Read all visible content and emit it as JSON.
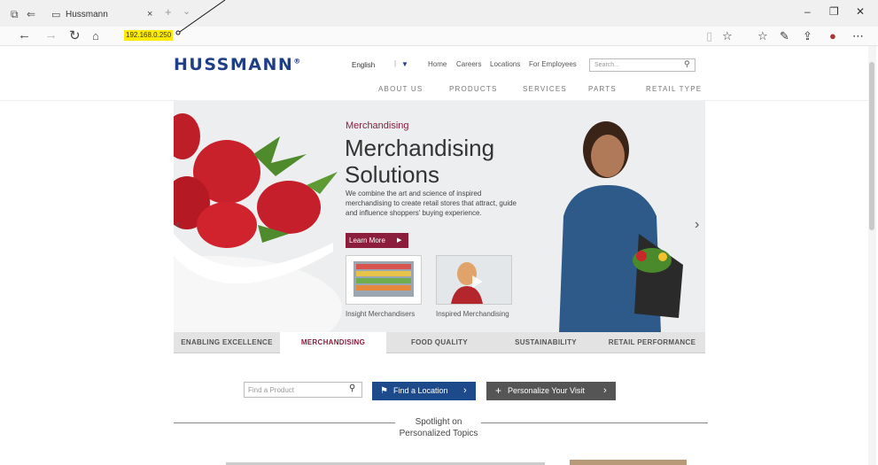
{
  "browser": {
    "tab_title": "Hussmann",
    "tab_close": "×",
    "new_tab": "+",
    "tab_menu": "⌄",
    "url": "192.168.0.250",
    "minimize": "–",
    "restore": "❐",
    "close": "✕"
  },
  "header": {
    "logo": "HUSSMANN",
    "logo_mark": "®",
    "language": "English",
    "top_links": [
      "Home",
      "Careers",
      "Locations",
      "For Employees"
    ],
    "search_placeholder": "Search...",
    "nav": [
      "ABOUT US",
      "PRODUCTS",
      "SERVICES",
      "PARTS",
      "RETAIL TYPE"
    ]
  },
  "hero": {
    "eyebrow": "Merchandising",
    "title": "Merchandising Solutions",
    "description": "We combine the art and science of inspired merchandising to create retail stores that attract, guide and influence shoppers' buying experience.",
    "cta": "Learn More",
    "thumbnails": [
      "Insight Merchandisers",
      "Inspired Merchandising"
    ],
    "tabs": [
      "ENABLING EXCELLENCE",
      "MERCHANDISING",
      "FOOD QUALITY",
      "SUSTAINABILITY",
      "RETAIL PERFORMANCE"
    ],
    "active_tab": "MERCHANDISING"
  },
  "tools": {
    "find_product_placeholder": "Find a Product",
    "find_location": "Find a Location",
    "personalize": "Personalize Your Visit"
  },
  "spotlight": {
    "heading": "Spotlight on Personalized Topics"
  },
  "colors": {
    "brand_blue": "#1f3e88",
    "accent_maroon": "#8b1d3d",
    "url_highlight": "#ffeb00"
  }
}
